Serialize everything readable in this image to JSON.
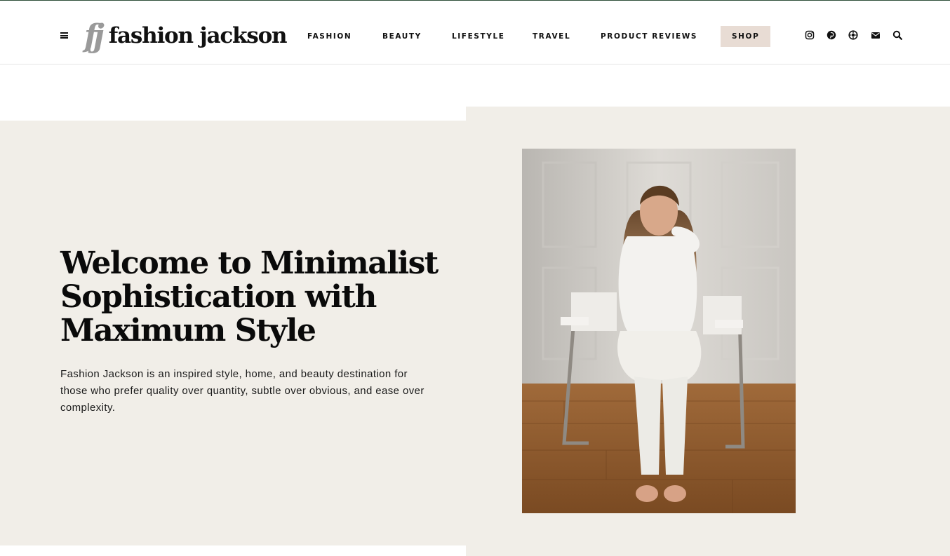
{
  "brand": {
    "logo_mark": "fj",
    "name": "fashion jackson"
  },
  "nav": {
    "items": [
      {
        "label": "FASHION"
      },
      {
        "label": "BEAUTY"
      },
      {
        "label": "LIFESTYLE"
      },
      {
        "label": "TRAVEL"
      },
      {
        "label": "PRODUCT REVIEWS"
      },
      {
        "label": "SHOP"
      }
    ]
  },
  "header_icons": [
    "menu-icon",
    "instagram-icon",
    "pinterest-icon",
    "liketoknowit-icon",
    "email-icon",
    "search-icon"
  ],
  "hero": {
    "title": "Welcome to Minimalist Sophistication with Maximum Style",
    "description": "Fashion Jackson is an inspired style, home, and beauty destination for those who prefer quality over quantity, subtle over obvious, and ease over complexity."
  },
  "colors": {
    "hero_background": "#f1eee8",
    "shop_button": "#e8dcd4",
    "top_border": "#2f4f3a",
    "text": "#111111"
  }
}
